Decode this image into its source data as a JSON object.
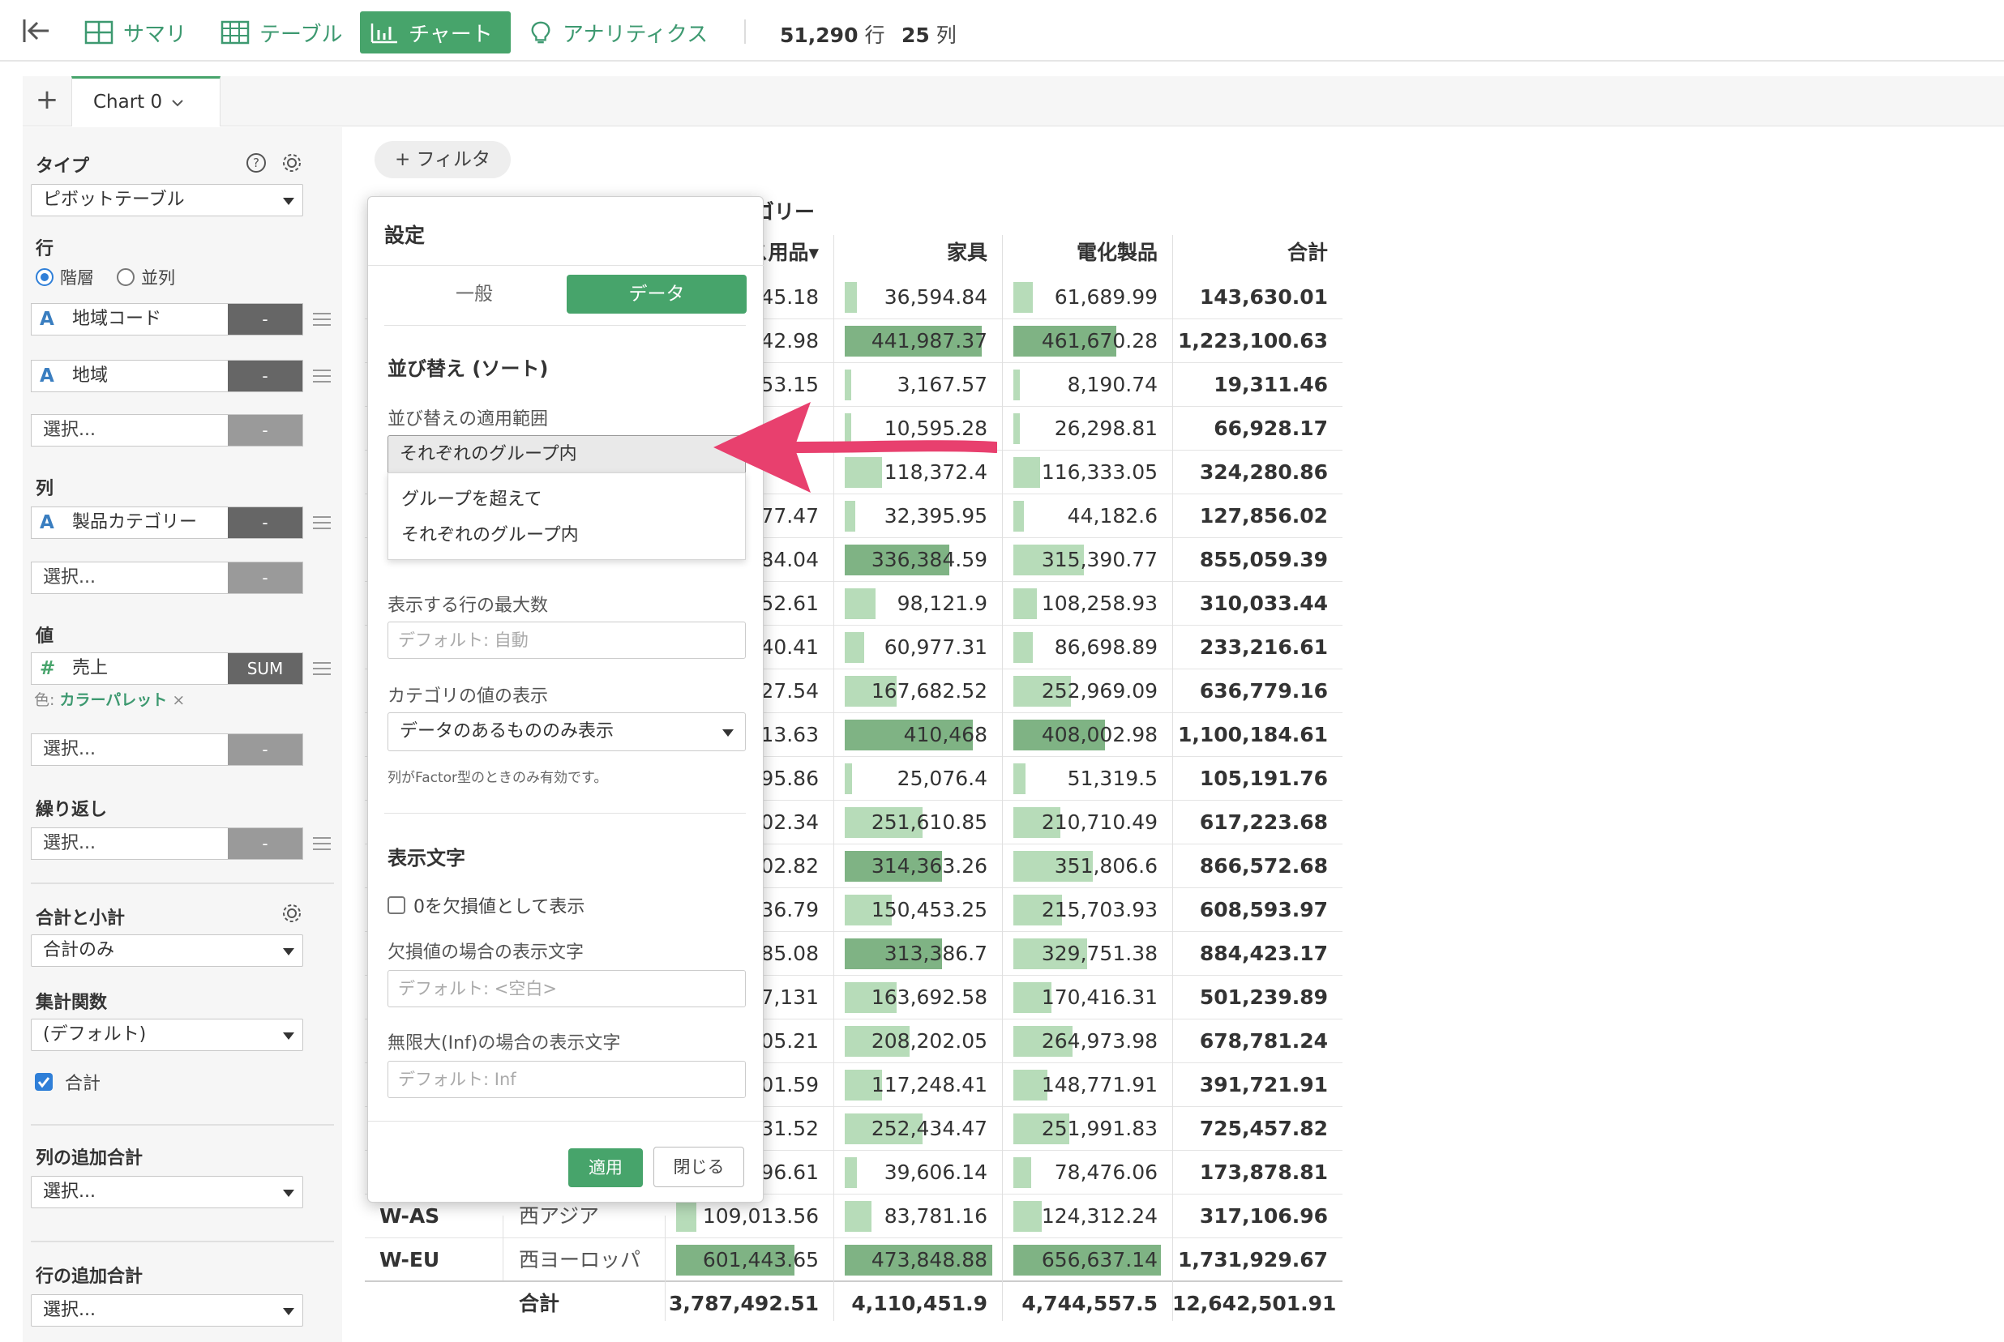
{
  "toolbar": {
    "tabs": [
      {
        "label": "サマリ",
        "icon": "grid-icon"
      },
      {
        "label": "テーブル",
        "icon": "table-icon"
      },
      {
        "label": "チャート",
        "icon": "bar-chart-icon"
      },
      {
        "label": "アナリティクス",
        "icon": "lightbulb-icon"
      }
    ],
    "rows_count": "51,290",
    "rows_unit": "行",
    "cols_count": "25",
    "cols_unit": "列"
  },
  "chart_tabs": {
    "add": "+",
    "active": "Chart 0"
  },
  "left_panel": {
    "type_label": "タイプ",
    "type_value": "ピボットテーブル",
    "rows_label": "行",
    "radio_hier": "階層",
    "radio_parallel": "並列",
    "row_fields": [
      {
        "type": "A",
        "name": "地域コード",
        "agg": "-"
      },
      {
        "type": "A",
        "name": "地域",
        "agg": "-"
      }
    ],
    "select_placeholder": "選択...",
    "dash": "-",
    "cols_label": "列",
    "col_field": {
      "type": "A",
      "name": "製品カテゴリー",
      "agg": "-"
    },
    "values_label": "値",
    "value_field": {
      "type": "#",
      "name": "売上",
      "agg": "SUM"
    },
    "color_prefix": "色:",
    "color_value": "カラーパレット",
    "color_remove": "×",
    "repeat_label": "繰り返し",
    "totals_label": "合計と小計",
    "totals_value": "合計のみ",
    "agg_func_label": "集計関数",
    "agg_func_value": "(デフォルト)",
    "total_check_label": "合計",
    "col_extra_label": "列の追加合計",
    "row_extra_label": "行の追加合計"
  },
  "filter_button": "+ フィルタ",
  "pivot": {
    "title_fragment": "ゴリー",
    "headers": [
      "ス用品▾",
      "家具",
      "電化製品",
      "合計"
    ],
    "rows": [
      {
        "key": "",
        "name": "",
        "c1": "45.18",
        "c2": "36,594.84",
        "c3": "61,689.99",
        "total": "143,630.01",
        "f2": 0.08,
        "f3": 0.13
      },
      {
        "key": "",
        "name": "",
        "c1": "42.98",
        "c2": "441,987.37",
        "c3": "461,670.28",
        "total": "1,223,100.63",
        "f2": 0.93,
        "f3": 0.7
      },
      {
        "key": "",
        "name": "",
        "c1": "53.15",
        "c2": "3,167.57",
        "c3": "8,190.74",
        "total": "19,311.46",
        "f2": 0.01,
        "f3": 0.01
      },
      {
        "key": "",
        "name": "",
        "c1": "",
        "c2": "10,595.28",
        "c3": "26,298.81",
        "total": "66,928.17",
        "f2": 0.02,
        "f3": 0.04
      },
      {
        "key": "",
        "name": "",
        "c1": "",
        "c2": "118,372.4",
        "c3": "116,333.05",
        "total": "324,280.86",
        "f2": 0.25,
        "f3": 0.18
      },
      {
        "key": "",
        "name": "",
        "c1": "77.47",
        "c2": "32,395.95",
        "c3": "44,182.6",
        "total": "127,856.02",
        "f2": 0.07,
        "f3": 0.07
      },
      {
        "key": "",
        "name": "",
        "c1": "84.04",
        "c2": "336,384.59",
        "c3": "315,390.77",
        "total": "855,059.39",
        "f2": 0.71,
        "f3": 0.48
      },
      {
        "key": "",
        "name": "",
        "c1": "52.61",
        "c2": "98,121.9",
        "c3": "108,258.93",
        "total": "310,033.44",
        "f2": 0.21,
        "f3": 0.16
      },
      {
        "key": "",
        "name": "",
        "c1": "40.41",
        "c2": "60,977.31",
        "c3": "86,698.89",
        "total": "233,216.61",
        "f2": 0.13,
        "f3": 0.13
      },
      {
        "key": "",
        "name": "",
        "c1": "27.54",
        "c2": "167,682.52",
        "c3": "252,969.09",
        "total": "636,779.16",
        "f2": 0.35,
        "f3": 0.39
      },
      {
        "key": "",
        "name": "",
        "c1": "13.63",
        "c2": "410,468",
        "c3": "408,002.98",
        "total": "1,100,184.61",
        "f2": 0.87,
        "f3": 0.62
      },
      {
        "key": "",
        "name": "",
        "c1": "95.86",
        "c2": "25,076.4",
        "c3": "51,319.5",
        "total": "105,191.76",
        "f2": 0.05,
        "f3": 0.08
      },
      {
        "key": "",
        "name": "",
        "c1": "02.34",
        "c2": "251,610.85",
        "c3": "210,710.49",
        "total": "617,223.68",
        "f2": 0.53,
        "f3": 0.32
      },
      {
        "key": "",
        "name": "",
        "c1": "02.82",
        "c2": "314,363.26",
        "c3": "351,806.6",
        "total": "866,572.68",
        "f2": 0.66,
        "f3": 0.54
      },
      {
        "key": "",
        "name": "",
        "c1": "36.79",
        "c2": "150,453.25",
        "c3": "215,703.93",
        "total": "608,593.97",
        "f2": 0.32,
        "f3": 0.33
      },
      {
        "key": "",
        "name": "",
        "c1": "85.08",
        "c2": "313,386.7",
        "c3": "329,751.38",
        "total": "884,423.17",
        "f2": 0.66,
        "f3": 0.5
      },
      {
        "key": "",
        "name": "",
        "c1": "7,131",
        "c2": "163,692.58",
        "c3": "170,416.31",
        "total": "501,239.89",
        "f2": 0.35,
        "f3": 0.26
      },
      {
        "key": "",
        "name": "",
        "c1": "05.21",
        "c2": "208,202.05",
        "c3": "264,973.98",
        "total": "678,781.24",
        "f2": 0.44,
        "f3": 0.4
      },
      {
        "key": "",
        "name": "",
        "c1": "01.59",
        "c2": "117,248.41",
        "c3": "148,771.91",
        "total": "391,721.91",
        "f2": 0.25,
        "f3": 0.23
      },
      {
        "key": "",
        "name": "",
        "c1": "31.52",
        "c2": "252,434.47",
        "c3": "251,991.83",
        "total": "725,457.82",
        "f2": 0.53,
        "f3": 0.38
      },
      {
        "key": "",
        "name": "",
        "c1": "96.61",
        "c2": "39,606.14",
        "c3": "78,476.06",
        "total": "173,878.81",
        "f2": 0.08,
        "f3": 0.12
      },
      {
        "key": "W-AS",
        "name": "西アジア",
        "c1": "109,013.56",
        "c2": "83,781.16",
        "c3": "124,312.24",
        "total": "317,106.96",
        "f1": 0.14,
        "f2": 0.18,
        "f3": 0.19
      },
      {
        "key": "W-EU",
        "name": "西ヨーロッパ",
        "c1": "601,443.65",
        "c2": "473,848.88",
        "c3": "656,637.14",
        "total": "1,731,929.67",
        "f1": 0.8,
        "f2": 1.0,
        "f3": 1.0
      }
    ],
    "grand_label": "合計",
    "grand": {
      "c1": "3,787,492.51",
      "c2": "4,110,451.9",
      "c3": "4,744,557.5",
      "total": "12,642,501.91"
    }
  },
  "dialog": {
    "title": "設定",
    "tab_general": "一般",
    "tab_data": "データ",
    "sort_section": "並び替え (ソート)",
    "sort_scope_label": "並び替えの適用範囲",
    "sort_scope_value": "それぞれのグループ内",
    "sort_scope_options": [
      "グループを超えて",
      "それぞれのグループ内"
    ],
    "max_rows_label": "表示する行の最大数",
    "max_rows_placeholder": "デフォルト: 自動",
    "category_label": "カテゴリの値の表示",
    "category_value": "データのあるもののみ表示",
    "category_note": "列がFactor型のときのみ有効です。",
    "display_section": "表示文字",
    "zero_as_na": "0を欠損値として表示",
    "na_text_label": "欠損値の場合の表示文字",
    "na_text_placeholder": "デフォルト: <空白>",
    "inf_text_label": "無限大(Inf)の場合の表示文字",
    "inf_text_placeholder": "デフォルト: Inf",
    "apply": "適用",
    "close": "閉じる"
  },
  "colors": {
    "accent": "#47a46b",
    "bar_light": "#b7dcb9",
    "bar_dark": "#7fb384",
    "arrow": "#e8406e"
  }
}
